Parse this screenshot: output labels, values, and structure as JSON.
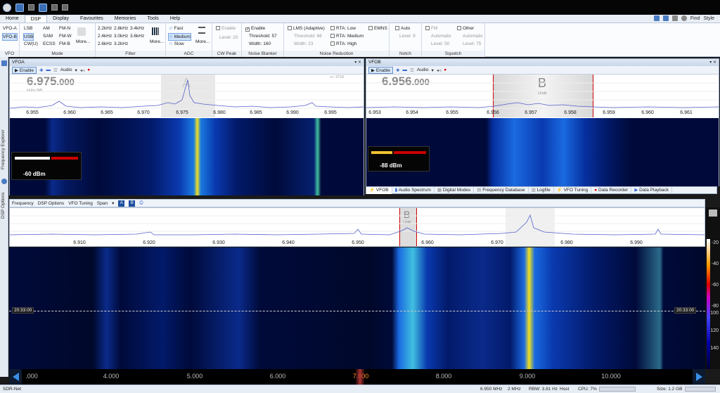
{
  "menu": {
    "tabs": [
      "Home",
      "DSP",
      "Display",
      "Favourites",
      "Memories",
      "Tools",
      "Help"
    ],
    "active": "DSP",
    "find": "Find",
    "style": "Style"
  },
  "ribbon": {
    "vfo": {
      "items": [
        "VFO-A",
        "VFO-B"
      ],
      "selected": "VFO-B",
      "caption": "VFO"
    },
    "mode": {
      "col1": [
        "LSB",
        "USB",
        "CW(U)"
      ],
      "col2": [
        "AM",
        "SAM",
        "ECSS"
      ],
      "col3": [
        "FM-N",
        "FM-W",
        "FM-B"
      ],
      "selected": "USB",
      "more": "More...",
      "caption": "Mode"
    },
    "filter": {
      "col1": [
        "2.2kHz",
        "2.4kHz",
        "2.6kHz"
      ],
      "col2": [
        "2.8kHz",
        "3.0kHz",
        "3.2kHz"
      ],
      "col3": [
        "3.4kHz",
        "3.6kHz"
      ],
      "more": "More...",
      "caption": "Filter"
    },
    "agc": {
      "items": [
        "Fast",
        "Medium",
        "Slow"
      ],
      "selected": "Medium",
      "more": "More...",
      "caption": "AGC"
    },
    "cwpeak": {
      "enable": "Enable",
      "level": "Level: 20",
      "caption": "CW Peak"
    },
    "nb": {
      "enable": "Enable",
      "threshold": "Threshold: 57",
      "width": "Width: 160",
      "caption": "Noise Blanker"
    },
    "nr": {
      "lms": "LMS (Adaptive)",
      "threshold": "Threshold: 68",
      "width": "Width: 23",
      "rta_low": "RTA: Low",
      "rta_medium": "RTA: Medium",
      "rta_high": "RTA: High",
      "emns": "EMNS",
      "caption": "Noise Reduction"
    },
    "notch": {
      "auto": "Auto",
      "level": "Level: 9",
      "caption": "Notch"
    },
    "squelch": {
      "fm": "FM",
      "automatic": "Automatic",
      "level": "Level: 50",
      "other": "Other",
      "automatic2": "Automatic",
      "level2": "Level: 75",
      "caption": "Squelch"
    }
  },
  "sidebar": {
    "freq_explorer": "Frequency Explorer",
    "dsp_options": "DSP Options"
  },
  "vfoa": {
    "title": "VFOA",
    "enable": "Enable",
    "audio": "Audio",
    "freq_main": "6.975",
    "freq_dec": ".000",
    "sub": "Hubs NB",
    "marker": "A",
    "smeter": "-60 dBm",
    "offset": "+/- 3716",
    "ticks": [
      "6.955",
      "6.960",
      "6.965",
      "6.970",
      "6.975",
      "6.980",
      "6.985",
      "6.990",
      "6.995"
    ]
  },
  "vfob": {
    "title": "VFOB",
    "enable": "Enable",
    "audio": "Audio",
    "freq_main": "6.956",
    "freq_dec": ".000",
    "marker": "B",
    "mode": "USB",
    "smeter": "-88 dBm",
    "ticks": [
      "6.953",
      "6.954",
      "6.955",
      "6.956",
      "6.957",
      "6.958",
      "6.959",
      "6.960",
      "6.961"
    ]
  },
  "bottom_tabs": [
    "VFOB",
    "Audio Spectrum",
    "Digital Modes",
    "Frequency Database",
    "Logfile",
    "VFO Tuning",
    "Data Recorder",
    "Data Playback"
  ],
  "main": {
    "toolbar": [
      "Frequency",
      "DSP Options",
      "VFO Tuning",
      "Span"
    ],
    "abtn": "A",
    "bbtn": "B",
    "marker": "B",
    "marker_sub": "USB",
    "spec_ticks": [
      "6.910",
      "6.920",
      "6.930",
      "6.940",
      "6.950",
      "6.960",
      "6.970",
      "6.980",
      "6.990"
    ],
    "time_left": "20:33:00",
    "time_right": "20:33:00",
    "scale": [
      "-20",
      "-40",
      "-60",
      "-80",
      "-100",
      "-120",
      "-140"
    ],
    "band": [
      "4.000",
      "5.000",
      "6.000",
      "7.000",
      "8.000",
      "9.000",
      "10.000"
    ],
    "band_edge": ".000"
  },
  "status": {
    "app": "SDR-Net",
    "freq": "6.950 MHz",
    "span": "2 MHz",
    "rbw": "RBW: 3.81 Hz",
    "host": "Host",
    "cpu": "CPU: 7%",
    "size": "Size: 1.2 GB"
  }
}
